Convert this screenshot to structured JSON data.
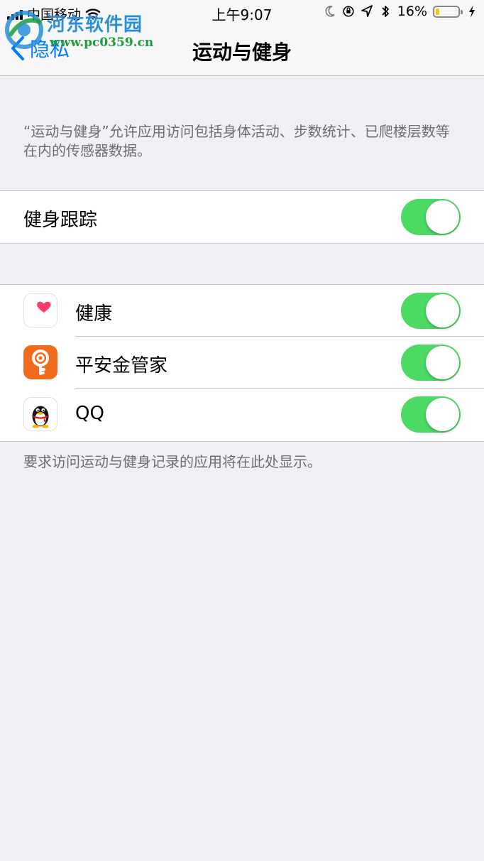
{
  "status_bar": {
    "carrier": "中国移动",
    "time": "上午9:07",
    "battery_percent": "16%",
    "battery_level": 0.16,
    "battery_color": "#f7c900",
    "icons": [
      "signal-icon",
      "wifi-icon",
      "moon-icon",
      "orientation-lock-icon",
      "location-icon",
      "bluetooth-icon",
      "battery-icon",
      "charging-icon"
    ]
  },
  "watermark": {
    "name": "河东软件园",
    "url": "www.pc0359.cn"
  },
  "nav": {
    "back_label": "隐私",
    "title": "运动与健身"
  },
  "description": "“运动与健身”允许应用访问包括身体活动、步数统计、已爬楼层数等在内的传感器数据。",
  "fitness_tracking": {
    "label": "健身跟踪",
    "enabled": true
  },
  "apps": [
    {
      "name": "健康",
      "icon": "health-heart-icon",
      "enabled": true
    },
    {
      "name": "平安金管家",
      "icon": "pingan-key-icon",
      "enabled": true
    },
    {
      "name": "QQ",
      "icon": "qq-penguin-icon",
      "enabled": true
    }
  ],
  "footer_note": "要求访问运动与健身记录的应用将在此处显示。",
  "colors": {
    "accent": "#007aff",
    "toggle_on": "#4cd964",
    "background": "#efeff4",
    "secondary_text": "#6d6d72"
  }
}
